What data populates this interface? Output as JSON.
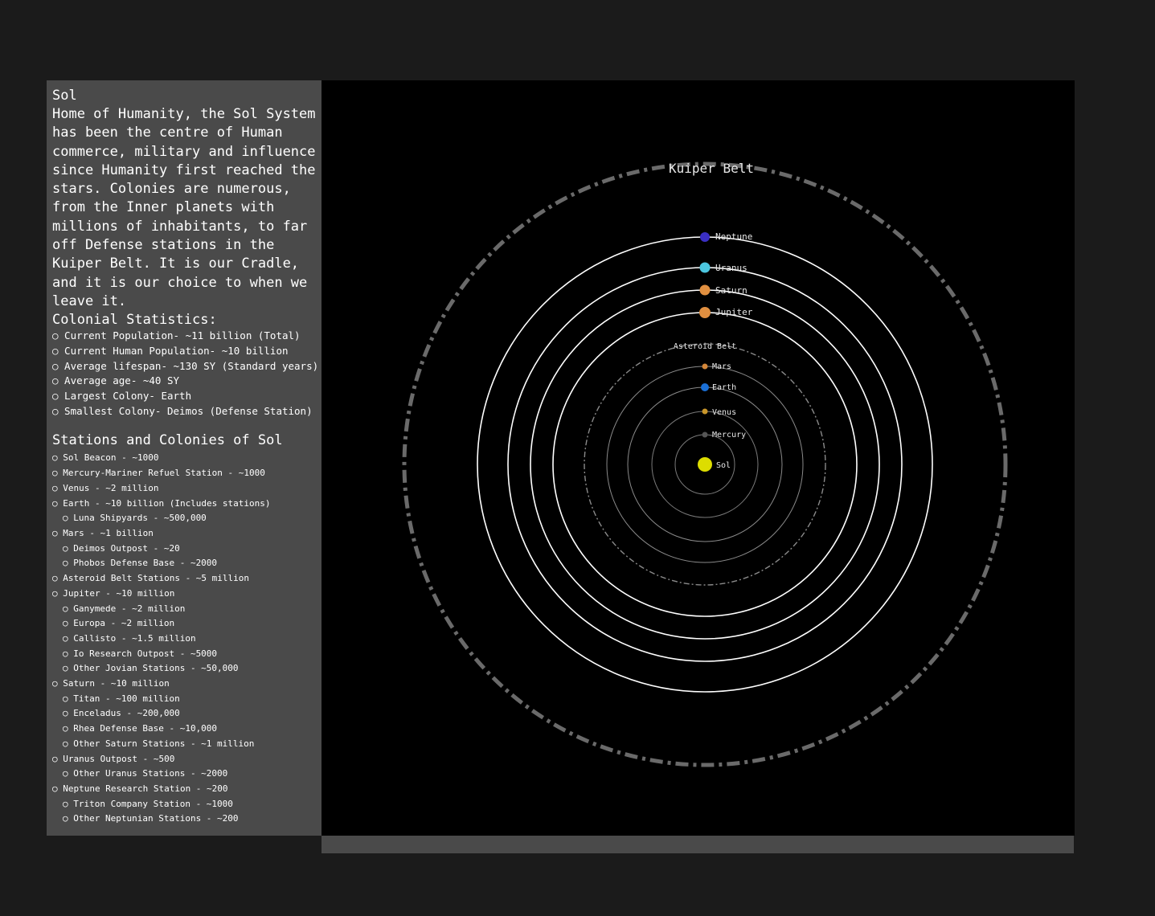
{
  "panel": {
    "title": "Sol",
    "description": "Home of Humanity, the Sol System has been the centre of Human commerce, military and influence since Humanity first reached the stars. Colonies are numerous, from the Inner planets with millions of inhabitants, to far off Defense stations in the Kuiper Belt. It is our Cradle, and it is our choice to when we leave it.",
    "stats_heading": "Colonial Statistics:",
    "stats": [
      "○ Current Population- ~11 billion (Total)",
      "○ Current Human Population- ~10 billion",
      "○ Average lifespan- ~130 SY (Standard years)",
      "○ Average age- ~40 SY",
      "○ Largest Colony- Earth",
      "○ Smallest Colony- Deimos (Defense Station)"
    ],
    "stations_heading": "Stations and Colonies of Sol",
    "stations": [
      {
        "text": "○ Sol Beacon - ~1000",
        "sub": false
      },
      {
        "text": "○ Mercury-Mariner Refuel Station - ~1000",
        "sub": false
      },
      {
        "text": "○ Venus - ~2 million",
        "sub": false
      },
      {
        "text": "○ Earth - ~10 billion (Includes stations)",
        "sub": false
      },
      {
        "text": "○ Luna Shipyards - ~500,000",
        "sub": true
      },
      {
        "text": "○ Mars - ~1 billion",
        "sub": false
      },
      {
        "text": "○ Deimos Outpost - ~20",
        "sub": true
      },
      {
        "text": "○ Phobos Defense Base - ~2000",
        "sub": true
      },
      {
        "text": "○ Asteroid Belt Stations - ~5 million",
        "sub": false
      },
      {
        "text": "○ Jupiter - ~10 million",
        "sub": false
      },
      {
        "text": "○ Ganymede - ~2 million",
        "sub": true
      },
      {
        "text": "○ Europa - ~2 million",
        "sub": true
      },
      {
        "text": "○ Callisto - ~1.5 million",
        "sub": true
      },
      {
        "text": "○ Io Research Outpost - ~5000",
        "sub": true
      },
      {
        "text": "○ Other Jovian Stations - ~50,000",
        "sub": true
      },
      {
        "text": "○ Saturn - ~10 million",
        "sub": false
      },
      {
        "text": "○ Titan - ~100 million",
        "sub": true
      },
      {
        "text": "○ Enceladus - ~200,000",
        "sub": true
      },
      {
        "text": "○ Rhea Defense Base - ~10,000",
        "sub": true
      },
      {
        "text": "○ Other Saturn Stations - ~1 million",
        "sub": true
      },
      {
        "text": "○ Uranus Outpost - ~500",
        "sub": false
      },
      {
        "text": "○ Other Uranus Stations - ~2000",
        "sub": true
      },
      {
        "text": "○ Neptune Research Station - ~200",
        "sub": false
      },
      {
        "text": "○ Triton Company Station - ~1000",
        "sub": true
      },
      {
        "text": "○ Other Neptunian Stations - ~200",
        "sub": true
      }
    ]
  },
  "map": {
    "star": {
      "name": "Sol",
      "color": "#dddd00"
    },
    "planets": [
      {
        "name": "Mercury",
        "color": "#555555",
        "orbit_style": "thin"
      },
      {
        "name": "Venus",
        "color": "#c8962a",
        "orbit_style": "thin"
      },
      {
        "name": "Earth",
        "color": "#1a6fd6",
        "orbit_style": "thin"
      },
      {
        "name": "Mars",
        "color": "#d4873a",
        "orbit_style": "thin"
      },
      {
        "name": "Jupiter",
        "color": "#e08f40",
        "orbit_style": "bright"
      },
      {
        "name": "Saturn",
        "color": "#e08f40",
        "orbit_style": "bright"
      },
      {
        "name": "Uranus",
        "color": "#4cc6df",
        "orbit_style": "bright"
      },
      {
        "name": "Neptune",
        "color": "#3a2fc4",
        "orbit_style": "bright"
      }
    ],
    "belts": [
      {
        "name": "Asteroid Belt",
        "style": "thin-dashdot"
      },
      {
        "name": "Kuiper Belt",
        "style": "thick-dashdot"
      }
    ]
  }
}
